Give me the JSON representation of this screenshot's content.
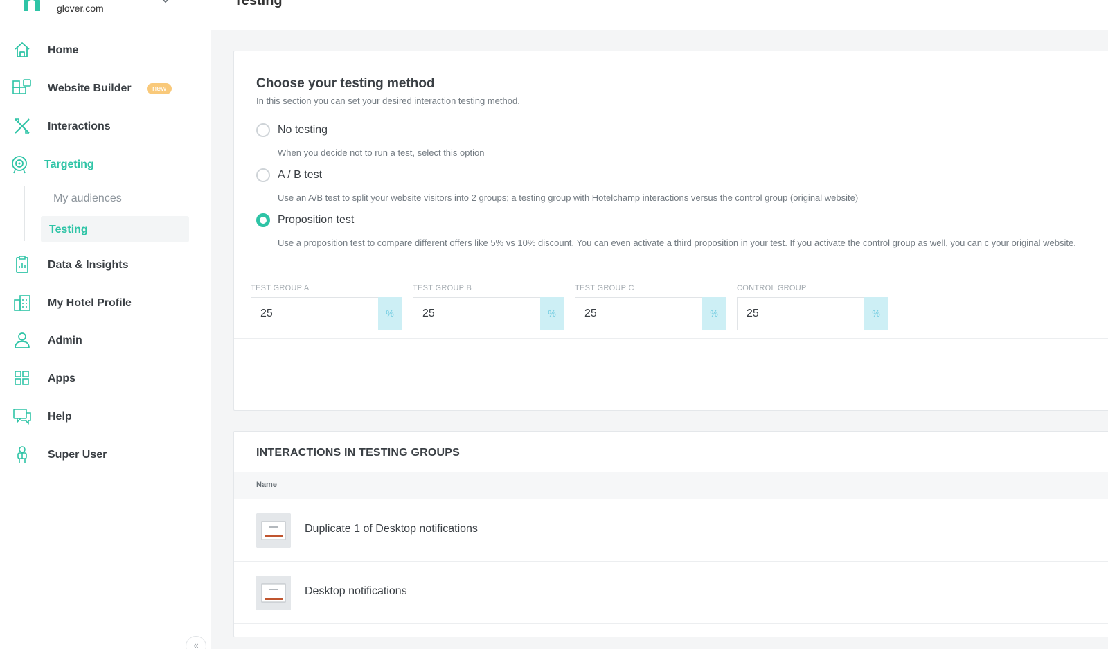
{
  "brand": {
    "domain": "glover.com",
    "accent_color": "#2ec4a6"
  },
  "sidebar": {
    "items": [
      {
        "label": "Home",
        "icon": "home-icon"
      },
      {
        "label": "Website Builder",
        "icon": "website-builder-icon",
        "badge": "new"
      },
      {
        "label": "Interactions",
        "icon": "interactions-icon"
      },
      {
        "label": "Targeting",
        "icon": "target-icon",
        "active": true
      },
      {
        "label": "Data & Insights",
        "icon": "clipboard-icon"
      },
      {
        "label": "My Hotel Profile",
        "icon": "hotel-icon"
      },
      {
        "label": "Admin",
        "icon": "user-icon"
      },
      {
        "label": "Apps",
        "icon": "apps-icon"
      },
      {
        "label": "Help",
        "icon": "chat-icon"
      },
      {
        "label": "Super User",
        "icon": "super-user-icon"
      }
    ],
    "sub_items": [
      {
        "label": "My audiences"
      },
      {
        "label": "Testing",
        "active": true
      }
    ],
    "collapse_label": "«"
  },
  "header": {
    "title": "Testing"
  },
  "testing_method": {
    "title": "Choose your testing method",
    "description": "In this section you can set your desired interaction testing method.",
    "options": [
      {
        "label": "No testing",
        "description": "When you decide not to run a test, select this option",
        "checked": false
      },
      {
        "label": "A / B test",
        "description": "Use an A/B test to split your website visitors into 2 groups; a testing group with Hotelchamp interactions versus the control group (original website)",
        "checked": false
      },
      {
        "label": "Proposition test",
        "description": "Use a proposition test to compare different offers like 5% vs 10% discount. You can even activate a third proposition in your test. If you activate the control group as well, you can c your original website.",
        "checked": true
      }
    ],
    "groups": [
      {
        "label": "TEST GROUP A",
        "value": "25",
        "unit": "%"
      },
      {
        "label": "TEST GROUP B",
        "value": "25",
        "unit": "%"
      },
      {
        "label": "TEST GROUP C",
        "value": "25",
        "unit": "%"
      },
      {
        "label": "CONTROL GROUP",
        "value": "25",
        "unit": "%"
      }
    ]
  },
  "interactions": {
    "title": "INTERACTIONS IN TESTING GROUPS",
    "column_name": "Name",
    "rows": [
      {
        "name": "Duplicate 1 of Desktop notifications"
      },
      {
        "name": "Desktop notifications"
      }
    ]
  }
}
